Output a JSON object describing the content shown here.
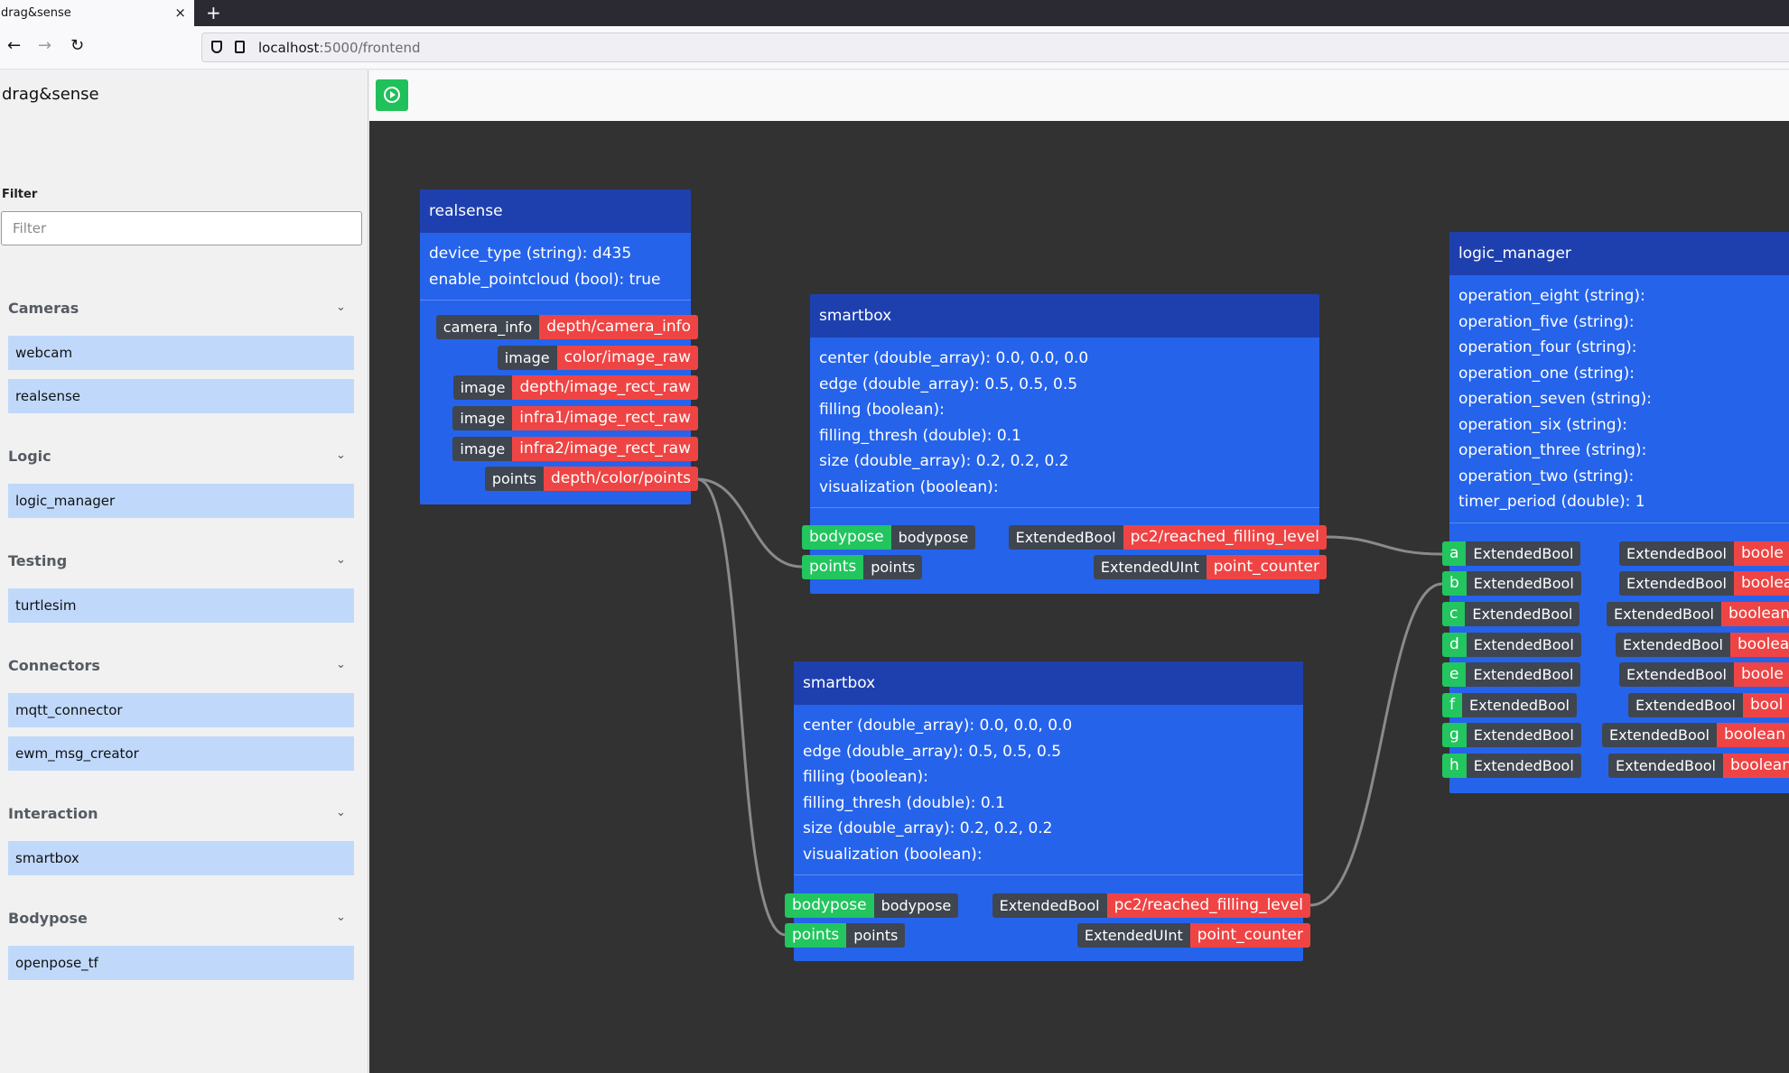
{
  "browser": {
    "tab_title": "drag&sense",
    "tab_close": "×",
    "new_tab": "+",
    "back": "←",
    "forward": "→",
    "reload": "↻",
    "url_host": "localhost",
    "url_rest": ":5000/frontend"
  },
  "sidebar": {
    "title": "drag&sense",
    "filter_label": "Filter",
    "filter_placeholder": "Filter",
    "categories": [
      {
        "name": "Cameras",
        "items": [
          "webcam",
          "realsense"
        ]
      },
      {
        "name": "Logic",
        "items": [
          "logic_manager"
        ]
      },
      {
        "name": "Testing",
        "items": [
          "turtlesim"
        ]
      },
      {
        "name": "Connectors",
        "items": [
          "mqtt_connector",
          "ewm_msg_creator"
        ]
      },
      {
        "name": "Interaction",
        "items": [
          "smartbox"
        ]
      },
      {
        "name": "Bodypose",
        "items": [
          "openpose_tf"
        ]
      }
    ]
  },
  "nodes": {
    "realsense": {
      "title": "realsense",
      "params": [
        "device_type (string): d435",
        "enable_pointcloud (bool): true"
      ],
      "outputs": [
        {
          "type": "camera_info",
          "topic": "depth/camera_info"
        },
        {
          "type": "image",
          "topic": "color/image_raw"
        },
        {
          "type": "image",
          "topic": "depth/image_rect_raw"
        },
        {
          "type": "image",
          "topic": "infra1/image_rect_raw"
        },
        {
          "type": "image",
          "topic": "infra2/image_rect_raw"
        },
        {
          "type": "points",
          "topic": "depth/color/points"
        }
      ]
    },
    "smartbox1": {
      "title": "smartbox",
      "params": [
        "center (double_array): 0.0, 0.0, 0.0",
        "edge (double_array): 0.5, 0.5, 0.5",
        "filling (boolean):",
        "filling_thresh (double): 0.1",
        "size (double_array): 0.2, 0.2, 0.2",
        "visualization (boolean):"
      ],
      "inputs": [
        {
          "name": "bodypose",
          "type": "bodypose"
        },
        {
          "name": "points",
          "type": "points"
        }
      ],
      "outputs": [
        {
          "type": "ExtendedBool",
          "topic": "pc2/reached_filling_level"
        },
        {
          "type": "ExtendedUInt",
          "topic": "point_counter"
        }
      ]
    },
    "smartbox2": {
      "title": "smartbox",
      "params": [
        "center (double_array): 0.0, 0.0, 0.0",
        "edge (double_array): 0.5, 0.5, 0.5",
        "filling (boolean):",
        "filling_thresh (double): 0.1",
        "size (double_array): 0.2, 0.2, 0.2",
        "visualization (boolean):"
      ],
      "inputs": [
        {
          "name": "bodypose",
          "type": "bodypose"
        },
        {
          "name": "points",
          "type": "points"
        }
      ],
      "outputs": [
        {
          "type": "ExtendedBool",
          "topic": "pc2/reached_filling_level"
        },
        {
          "type": "ExtendedUInt",
          "topic": "point_counter"
        }
      ]
    },
    "logic_manager": {
      "title": "logic_manager",
      "params": [
        "operation_eight (string):",
        "operation_five (string):",
        "operation_four (string):",
        "operation_one (string):",
        "operation_seven (string):",
        "operation_six (string):",
        "operation_three (string):",
        "operation_two (string):",
        "timer_period (double): 1"
      ],
      "inputs": [
        {
          "name": "a",
          "type": "ExtendedBool"
        },
        {
          "name": "b",
          "type": "ExtendedBool"
        },
        {
          "name": "c",
          "type": "ExtendedBool"
        },
        {
          "name": "d",
          "type": "ExtendedBool"
        },
        {
          "name": "e",
          "type": "ExtendedBool"
        },
        {
          "name": "f",
          "type": "ExtendedBool"
        },
        {
          "name": "g",
          "type": "ExtendedBool"
        },
        {
          "name": "h",
          "type": "ExtendedBool"
        }
      ],
      "outputs": [
        {
          "type": "ExtendedBool",
          "topic": "boole"
        },
        {
          "type": "ExtendedBool",
          "topic": "boolea"
        },
        {
          "type": "ExtendedBool",
          "topic": "boolean"
        },
        {
          "type": "ExtendedBool",
          "topic": "boolea"
        },
        {
          "type": "ExtendedBool",
          "topic": "boole"
        },
        {
          "type": "ExtendedBool",
          "topic": "bool"
        },
        {
          "type": "ExtendedBool",
          "topic": "boolean"
        },
        {
          "type": "ExtendedBool",
          "topic": "boolean"
        }
      ]
    }
  }
}
